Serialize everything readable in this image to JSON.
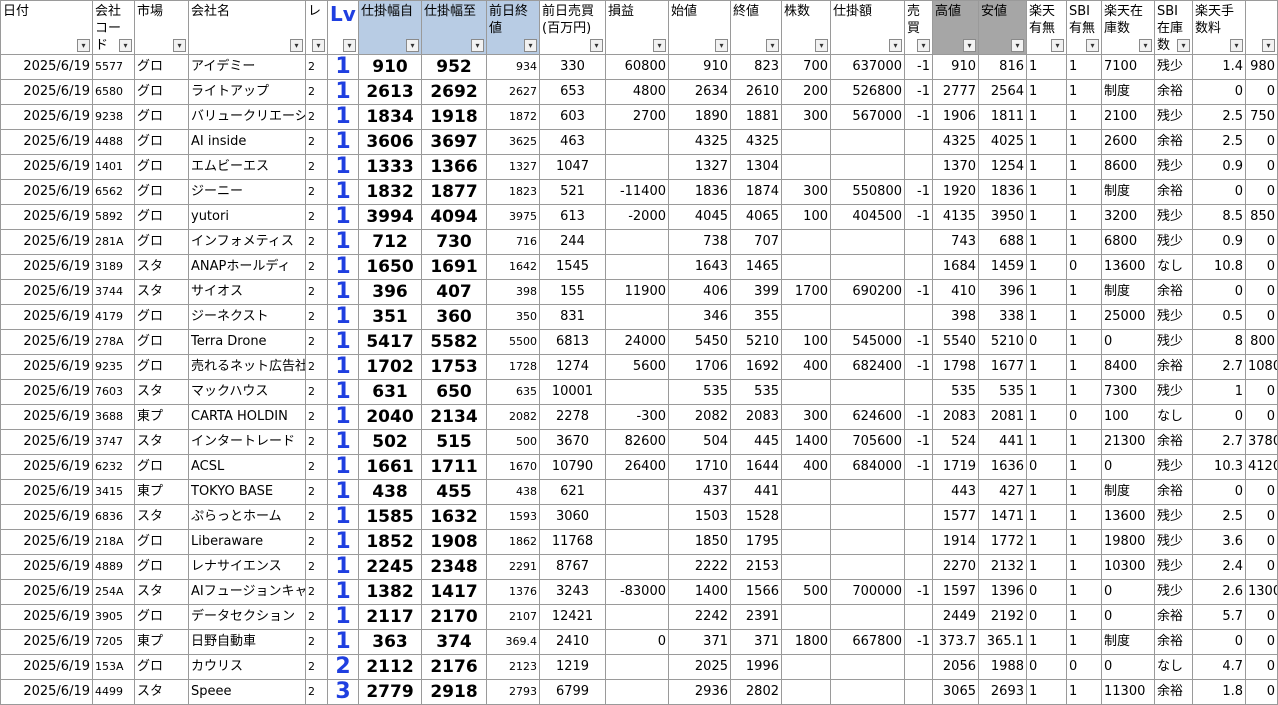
{
  "headers": [
    {
      "label": "日付",
      "style": ""
    },
    {
      "label": "会社コード",
      "style": ""
    },
    {
      "label": "市場",
      "style": ""
    },
    {
      "label": "会社名",
      "style": ""
    },
    {
      "label": "レ",
      "style": ""
    },
    {
      "label": "Lv",
      "style": "lv"
    },
    {
      "label": "仕掛幅自",
      "style": "blue"
    },
    {
      "label": "仕掛幅至",
      "style": "blue"
    },
    {
      "label": "前日終値",
      "style": "blue"
    },
    {
      "label": "前日売買(百万円)",
      "style": ""
    },
    {
      "label": "損益",
      "style": ""
    },
    {
      "label": "始値",
      "style": ""
    },
    {
      "label": "終値",
      "style": ""
    },
    {
      "label": "株数",
      "style": ""
    },
    {
      "label": "仕掛額",
      "style": ""
    },
    {
      "label": "売買",
      "style": ""
    },
    {
      "label": "高値",
      "style": "gray"
    },
    {
      "label": "安値",
      "style": "gray"
    },
    {
      "label": "楽天有無",
      "style": ""
    },
    {
      "label": "SBI有無",
      "style": ""
    },
    {
      "label": "楽天在庫数",
      "style": ""
    },
    {
      "label": "SBI在庫数",
      "style": ""
    },
    {
      "label": "楽天手数料",
      "style": ""
    },
    {
      "label": "",
      "style": ""
    }
  ],
  "rows": [
    [
      "2025/6/19",
      "5577",
      "グロ",
      "アイデミー",
      "2",
      "1",
      "910",
      "952",
      "934",
      "330",
      "60800",
      "910",
      "823",
      "700",
      "637000",
      "-1",
      "910",
      "816",
      "1",
      "1",
      "7100",
      "残少",
      "1.4",
      "980"
    ],
    [
      "2025/6/19",
      "6580",
      "グロ",
      "ライトアップ",
      "2",
      "1",
      "2613",
      "2692",
      "2627",
      "653",
      "4800",
      "2634",
      "2610",
      "200",
      "526800",
      "-1",
      "2777",
      "2564",
      "1",
      "1",
      "制度",
      "余裕",
      "0",
      "0"
    ],
    [
      "2025/6/19",
      "9238",
      "グロ",
      "バリュークリエーシ",
      "2",
      "1",
      "1834",
      "1918",
      "1872",
      "603",
      "2700",
      "1890",
      "1881",
      "300",
      "567000",
      "-1",
      "1906",
      "1811",
      "1",
      "1",
      "2100",
      "残少",
      "2.5",
      "750"
    ],
    [
      "2025/6/19",
      "4488",
      "グロ",
      "AI inside",
      "2",
      "1",
      "3606",
      "3697",
      "3625",
      "463",
      "",
      "4325",
      "4325",
      "",
      "",
      "",
      "4325",
      "4025",
      "1",
      "1",
      "2600",
      "余裕",
      "2.5",
      "0"
    ],
    [
      "2025/6/19",
      "1401",
      "グロ",
      "エムビーエス",
      "2",
      "1",
      "1333",
      "1366",
      "1327",
      "1047",
      "",
      "1327",
      "1304",
      "",
      "",
      "",
      "1370",
      "1254",
      "1",
      "1",
      "8600",
      "残少",
      "0.9",
      "0"
    ],
    [
      "2025/6/19",
      "6562",
      "グロ",
      "ジーニー",
      "2",
      "1",
      "1832",
      "1877",
      "1823",
      "521",
      "-11400",
      "1836",
      "1874",
      "300",
      "550800",
      "-1",
      "1920",
      "1836",
      "1",
      "1",
      "制度",
      "余裕",
      "0",
      "0"
    ],
    [
      "2025/6/19",
      "5892",
      "グロ",
      "yutori",
      "2",
      "1",
      "3994",
      "4094",
      "3975",
      "613",
      "-2000",
      "4045",
      "4065",
      "100",
      "404500",
      "-1",
      "4135",
      "3950",
      "1",
      "1",
      "3200",
      "残少",
      "8.5",
      "850"
    ],
    [
      "2025/6/19",
      "281A",
      "グロ",
      "インフォメティス",
      "2",
      "1",
      "712",
      "730",
      "716",
      "244",
      "",
      "738",
      "707",
      "",
      "",
      "",
      "743",
      "688",
      "1",
      "1",
      "6800",
      "残少",
      "0.9",
      "0"
    ],
    [
      "2025/6/19",
      "3189",
      "スタ",
      "ANAPホールディ",
      "2",
      "1",
      "1650",
      "1691",
      "1642",
      "1545",
      "",
      "1643",
      "1465",
      "",
      "",
      "",
      "1684",
      "1459",
      "1",
      "0",
      "13600",
      "なし",
      "10.8",
      "0"
    ],
    [
      "2025/6/19",
      "3744",
      "スタ",
      "サイオス",
      "2",
      "1",
      "396",
      "407",
      "398",
      "155",
      "11900",
      "406",
      "399",
      "1700",
      "690200",
      "-1",
      "410",
      "396",
      "1",
      "1",
      "制度",
      "余裕",
      "0",
      "0"
    ],
    [
      "2025/6/19",
      "4179",
      "グロ",
      "ジーネクスト",
      "2",
      "1",
      "351",
      "360",
      "350",
      "831",
      "",
      "346",
      "355",
      "",
      "",
      "",
      "398",
      "338",
      "1",
      "1",
      "25000",
      "残少",
      "0.5",
      "0"
    ],
    [
      "2025/6/19",
      "278A",
      "グロ",
      "Terra Drone",
      "2",
      "1",
      "5417",
      "5582",
      "5500",
      "6813",
      "24000",
      "5450",
      "5210",
      "100",
      "545000",
      "-1",
      "5540",
      "5210",
      "0",
      "1",
      "0",
      "残少",
      "8",
      "800"
    ],
    [
      "2025/6/19",
      "9235",
      "グロ",
      "売れるネット広告社",
      "2",
      "1",
      "1702",
      "1753",
      "1728",
      "1274",
      "5600",
      "1706",
      "1692",
      "400",
      "682400",
      "-1",
      "1798",
      "1677",
      "1",
      "1",
      "8400",
      "余裕",
      "2.7",
      "1080"
    ],
    [
      "2025/6/19",
      "7603",
      "スタ",
      "マックハウス",
      "2",
      "1",
      "631",
      "650",
      "635",
      "10001",
      "",
      "535",
      "535",
      "",
      "",
      "",
      "535",
      "535",
      "1",
      "1",
      "7300",
      "残少",
      "1",
      "0"
    ],
    [
      "2025/6/19",
      "3688",
      "東プ",
      "CARTA HOLDIN",
      "2",
      "1",
      "2040",
      "2134",
      "2082",
      "2278",
      "-300",
      "2082",
      "2083",
      "300",
      "624600",
      "-1",
      "2083",
      "2081",
      "1",
      "0",
      "100",
      "なし",
      "0",
      "0"
    ],
    [
      "2025/6/19",
      "3747",
      "スタ",
      "インタートレード",
      "2",
      "1",
      "502",
      "515",
      "500",
      "3670",
      "82600",
      "504",
      "445",
      "1400",
      "705600",
      "-1",
      "524",
      "441",
      "1",
      "1",
      "21300",
      "余裕",
      "2.7",
      "3780"
    ],
    [
      "2025/6/19",
      "6232",
      "グロ",
      "ACSL",
      "2",
      "1",
      "1661",
      "1711",
      "1670",
      "10790",
      "26400",
      "1710",
      "1644",
      "400",
      "684000",
      "-1",
      "1719",
      "1636",
      "0",
      "1",
      "0",
      "残少",
      "10.3",
      "4120"
    ],
    [
      "2025/6/19",
      "3415",
      "東プ",
      "TOKYO BASE",
      "2",
      "1",
      "438",
      "455",
      "438",
      "621",
      "",
      "437",
      "441",
      "",
      "",
      "",
      "443",
      "427",
      "1",
      "1",
      "制度",
      "余裕",
      "0",
      "0"
    ],
    [
      "2025/6/19",
      "6836",
      "スタ",
      "ぷらっとホーム",
      "2",
      "1",
      "1585",
      "1632",
      "1593",
      "3060",
      "",
      "1503",
      "1528",
      "",
      "",
      "",
      "1577",
      "1471",
      "1",
      "1",
      "13600",
      "残少",
      "2.5",
      "0"
    ],
    [
      "2025/6/19",
      "218A",
      "グロ",
      "Liberaware",
      "2",
      "1",
      "1852",
      "1908",
      "1862",
      "11768",
      "",
      "1850",
      "1795",
      "",
      "",
      "",
      "1914",
      "1772",
      "1",
      "1",
      "19800",
      "残少",
      "3.6",
      "0"
    ],
    [
      "2025/6/19",
      "4889",
      "グロ",
      "レナサイエンス",
      "2",
      "1",
      "2245",
      "2348",
      "2291",
      "8767",
      "",
      "2222",
      "2153",
      "",
      "",
      "",
      "2270",
      "2132",
      "1",
      "1",
      "10300",
      "残少",
      "2.4",
      "0"
    ],
    [
      "2025/6/19",
      "254A",
      "スタ",
      "AIフュージョンキャ",
      "2",
      "1",
      "1382",
      "1417",
      "1376",
      "3243",
      "-83000",
      "1400",
      "1566",
      "500",
      "700000",
      "-1",
      "1597",
      "1396",
      "0",
      "1",
      "0",
      "残少",
      "2.6",
      "1300"
    ],
    [
      "2025/6/19",
      "3905",
      "グロ",
      "データセクション",
      "2",
      "1",
      "2117",
      "2170",
      "2107",
      "12421",
      "",
      "2242",
      "2391",
      "",
      "",
      "",
      "2449",
      "2192",
      "0",
      "1",
      "0",
      "余裕",
      "5.7",
      "0"
    ],
    [
      "2025/6/19",
      "7205",
      "東プ",
      "日野自動車",
      "2",
      "1",
      "363",
      "374",
      "369.4",
      "2410",
      "0",
      "371",
      "371",
      "1800",
      "667800",
      "-1",
      "373.7",
      "365.1",
      "1",
      "1",
      "制度",
      "余裕",
      "0",
      "0"
    ],
    [
      "2025/6/19",
      "153A",
      "グロ",
      "カウリス",
      "2",
      "2",
      "2112",
      "2176",
      "2123",
      "1219",
      "",
      "2025",
      "1996",
      "",
      "",
      "",
      "2056",
      "1988",
      "0",
      "0",
      "0",
      "なし",
      "4.7",
      "0"
    ],
    [
      "2025/6/19",
      "4499",
      "スタ",
      "Speee",
      "2",
      "3",
      "2779",
      "2918",
      "2793",
      "6799",
      "",
      "2936",
      "2802",
      "",
      "",
      "",
      "3065",
      "2693",
      "1",
      "1",
      "11300",
      "余裕",
      "1.8",
      "0"
    ]
  ]
}
